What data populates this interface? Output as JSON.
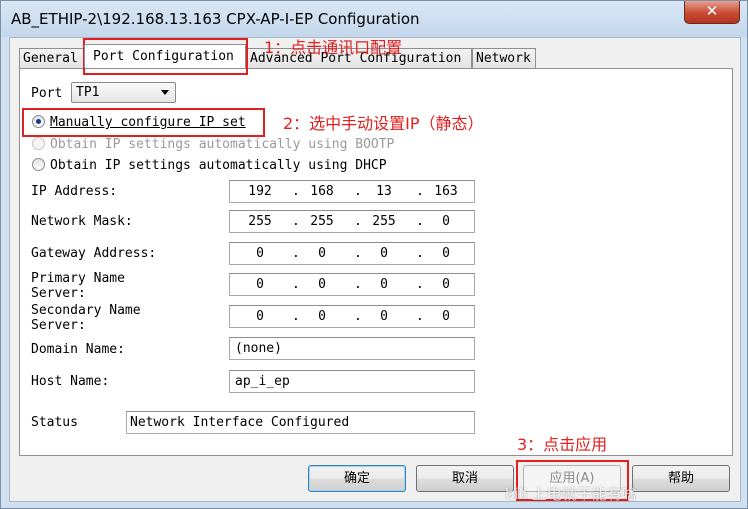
{
  "window": {
    "title": "AB_ETHIP-2\\192.168.13.163 CPX-AP-I-EP Configuration",
    "close_symbol": "✕"
  },
  "tabs": [
    {
      "label": "General"
    },
    {
      "label": "Port Configuration"
    },
    {
      "label": "Advanced Port Configuration"
    },
    {
      "label": "Network"
    }
  ],
  "port": {
    "label": "Port",
    "value": "TP1"
  },
  "radios": {
    "manual": "Manually configure IP set",
    "bootp": "Obtain IP settings automatically using BOOTP",
    "dhcp": "Obtain IP settings automatically using DHCP"
  },
  "fields": {
    "ip": {
      "label": "IP Address:",
      "octets": [
        "192",
        "168",
        "13",
        "163"
      ]
    },
    "mask": {
      "label": "Network Mask:",
      "octets": [
        "255",
        "255",
        "255",
        "0"
      ]
    },
    "gateway": {
      "label": "Gateway Address:",
      "octets": [
        "0",
        "0",
        "0",
        "0"
      ]
    },
    "primary": {
      "label_1": "Primary Name",
      "label_2": "Server:",
      "octets": [
        "0",
        "0",
        "0",
        "0"
      ]
    },
    "secondary": {
      "label_1": "Secondary Name",
      "label_2": "Server:",
      "octets": [
        "0",
        "0",
        "0",
        "0"
      ]
    },
    "domain": {
      "label": "Domain Name:",
      "value": "(none)"
    },
    "host": {
      "label": "Host Name:",
      "value": "ap_i_ep"
    }
  },
  "status": {
    "label": "Status",
    "value": "Network Interface Configured"
  },
  "buttons": {
    "ok": "确定",
    "cancel": "取消",
    "apply": "应用(A)",
    "help": "帮助"
  },
  "annotations": {
    "step1": "1：点击通讯口配置",
    "step2": "2：选中手动设置IP（静态）",
    "step3": "3：点击应用"
  },
  "watermark": "bili 上电就干能有啥"
}
